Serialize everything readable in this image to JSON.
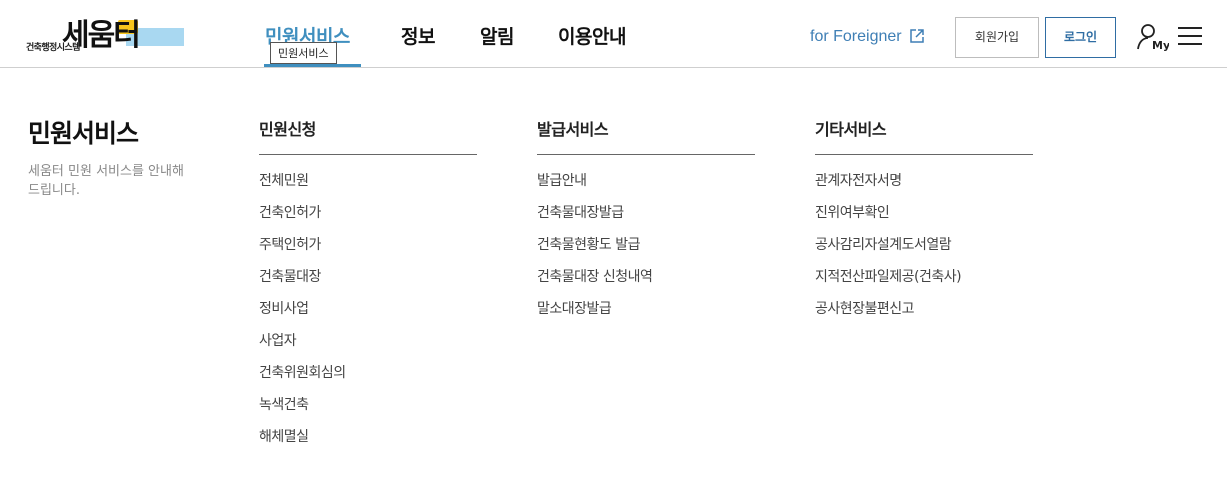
{
  "logo": {
    "main": "세움터",
    "sub": "건축행정시스템"
  },
  "nav": {
    "items": [
      {
        "label": "민원서비스"
      },
      {
        "label": "정보"
      },
      {
        "label": "알림"
      },
      {
        "label": "이용안내"
      }
    ],
    "active_tooltip": "민원서비스"
  },
  "utility": {
    "foreigner_label": "for Foreigner",
    "join_label": "회원가입",
    "login_label": "로그인",
    "my_label": "My"
  },
  "colors": {
    "accent": "#3f8fbf",
    "login_border": "#2f6da3",
    "foreigner_text": "#3f7fb5"
  },
  "icons": {
    "external": "external-link-icon",
    "my": "user-my-icon",
    "menu": "hamburger-menu-icon"
  },
  "mega": {
    "title": "민원서비스",
    "desc": "세움터 민원 서비스를 안내해드립니다.",
    "columns": [
      {
        "title": "민원신청",
        "items": [
          "전체민원",
          "건축인허가",
          "주택인허가",
          "건축물대장",
          "정비사업",
          "사업자",
          "건축위원회심의",
          "녹색건축",
          "해체멸실"
        ]
      },
      {
        "title": "발급서비스",
        "items": [
          "발급안내",
          "건축물대장발급",
          "건축물현황도 발급",
          "건축물대장 신청내역",
          "말소대장발급"
        ]
      },
      {
        "title": "기타서비스",
        "items": [
          "관계자전자서명",
          "진위여부확인",
          "공사감리자설계도서열람",
          "지적전산파일제공(건축사)",
          "공사현장불편신고"
        ]
      }
    ]
  }
}
